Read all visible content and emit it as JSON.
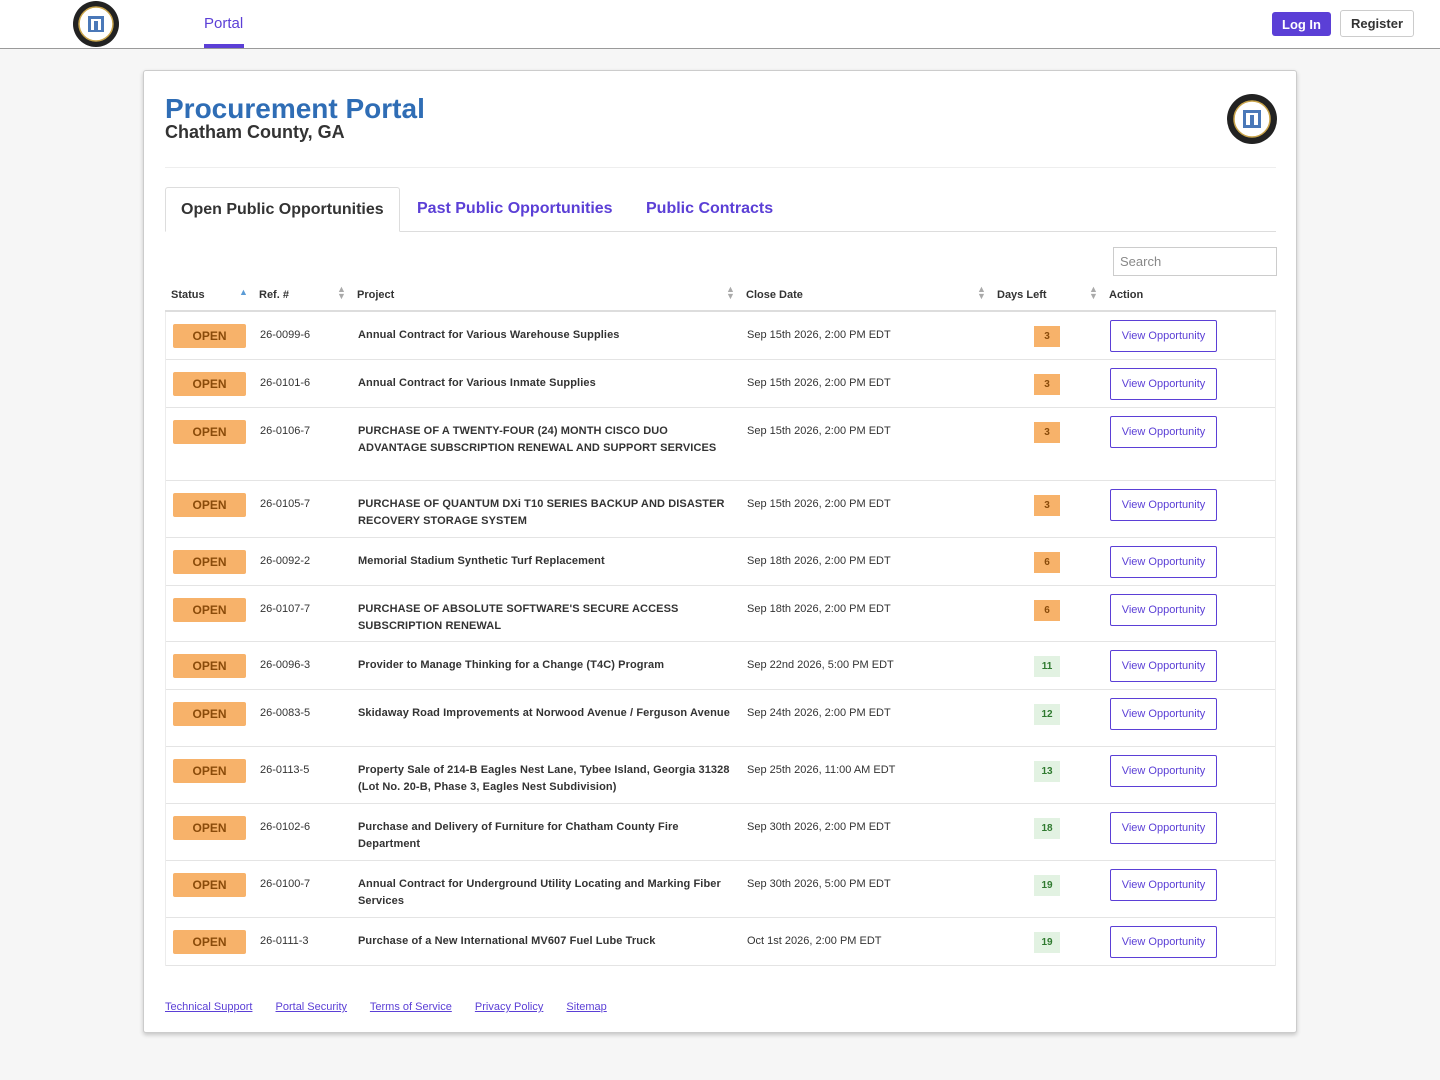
{
  "nav": {
    "portal_label": "Portal",
    "login_label": "Log In",
    "register_label": "Register"
  },
  "header": {
    "title": "Procurement Portal",
    "subtitle": "Chatham County, GA"
  },
  "tabs": [
    "Open Public Opportunities",
    "Past Public Opportunities",
    "Public Contracts"
  ],
  "search": {
    "placeholder": "Search"
  },
  "table": {
    "columns": [
      "Status",
      "Ref. #",
      "Project",
      "Close Date",
      "Days Left",
      "Action"
    ],
    "rows": [
      {
        "status": "OPEN",
        "ref": "26-0099-6",
        "project": "Annual Contract for Various Warehouse Supplies",
        "close": "Sep 15th 2026, 2:00 PM EDT",
        "days": "3",
        "action": "View Opportunity"
      },
      {
        "status": "OPEN",
        "ref": "26-0101-6",
        "project": "Annual Contract for Various Inmate Supplies",
        "close": "Sep 15th 2026, 2:00 PM EDT",
        "days": "3",
        "action": "View Opportunity"
      },
      {
        "status": "OPEN",
        "ref": "26-0106-7",
        "project": "PURCHASE OF A TWENTY-FOUR (24) MONTH CISCO DUO ADVANTAGE SUBSCRIPTION RENEWAL AND SUPPORT SERVICES",
        "close": "Sep 15th 2026, 2:00 PM EDT",
        "days": "3",
        "action": "View Opportunity"
      },
      {
        "status": "OPEN",
        "ref": "26-0105-7",
        "project": "PURCHASE OF QUANTUM DXi T10 SERIES BACKUP AND DISASTER RECOVERY STORAGE SYSTEM",
        "close": "Sep 15th 2026, 2:00 PM EDT",
        "days": "3",
        "action": "View Opportunity"
      },
      {
        "status": "OPEN",
        "ref": "26-0092-2",
        "project": "Memorial Stadium Synthetic Turf Replacement",
        "close": "Sep 18th 2026, 2:00 PM EDT",
        "days": "6",
        "action": "View Opportunity"
      },
      {
        "status": "OPEN",
        "ref": "26-0107-7",
        "project": "PURCHASE OF ABSOLUTE SOFTWARE'S SECURE ACCESS SUBSCRIPTION RENEWAL",
        "close": "Sep 18th 2026, 2:00 PM EDT",
        "days": "6",
        "action": "View Opportunity"
      },
      {
        "status": "OPEN",
        "ref": "26-0096-3",
        "project": "Provider to Manage Thinking for a Change (T4C) Program",
        "close": "Sep 22nd 2026, 5:00 PM EDT",
        "days": "11",
        "action": "View Opportunity"
      },
      {
        "status": "OPEN",
        "ref": "26-0083-5",
        "project": "Skidaway Road Improvements at Norwood Avenue / Ferguson Avenue",
        "close": "Sep 24th 2026, 2:00 PM EDT",
        "days": "12",
        "action": "View Opportunity"
      },
      {
        "status": "OPEN",
        "ref": "26-0113-5",
        "project": "Property Sale of 214-B Eagles Nest Lane, Tybee Island, Georgia 31328 (Lot No. 20-B, Phase 3, Eagles Nest Subdivision)",
        "close": "Sep 25th 2026, 11:00 AM EDT",
        "days": "13",
        "action": "View Opportunity"
      },
      {
        "status": "OPEN",
        "ref": "26-0102-6",
        "project": "Purchase and Delivery of Furniture for Chatham County Fire Department",
        "close": "Sep 30th 2026, 2:00 PM EDT",
        "days": "18",
        "action": "View Opportunity"
      },
      {
        "status": "OPEN",
        "ref": "26-0100-7",
        "project": "Annual Contract for Underground Utility Locating and Marking Fiber Services",
        "close": "Sep 30th 2026, 5:00 PM EDT",
        "days": "19",
        "action": "View Opportunity"
      },
      {
        "status": "OPEN",
        "ref": "26-0111-3",
        "project": "Purchase of a New International MV607 Fuel Lube Truck",
        "close": "Oct 1st 2026, 2:00 PM EDT",
        "days": "19",
        "action": "View Opportunity"
      }
    ]
  },
  "footer": [
    "Technical Support",
    "Portal Security",
    "Terms of Service",
    "Privacy Policy",
    "Sitemap"
  ],
  "colors": {
    "accent": "#5b3fd6",
    "title": "#2f6db5",
    "open_badge": "#f7b26a",
    "days_ok": "#e2f2e2"
  },
  "icons": {
    "seal": "county-seal-icon",
    "sort": "sort-arrows-icon"
  }
}
